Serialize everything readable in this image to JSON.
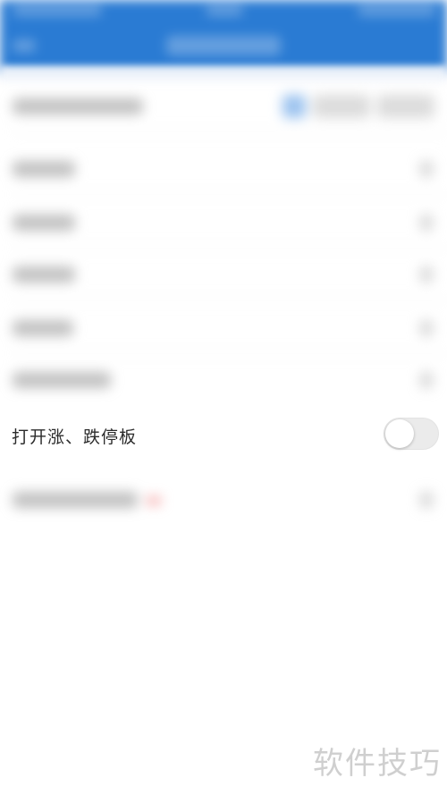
{
  "settings": {
    "limit_board_toggle": {
      "label": "打开涨、跌停板",
      "state": "off"
    }
  },
  "watermark": {
    "text": "软件技巧"
  },
  "colors": {
    "header_bg": "#2a7bd3",
    "toggle_track": "#ebebeb"
  }
}
